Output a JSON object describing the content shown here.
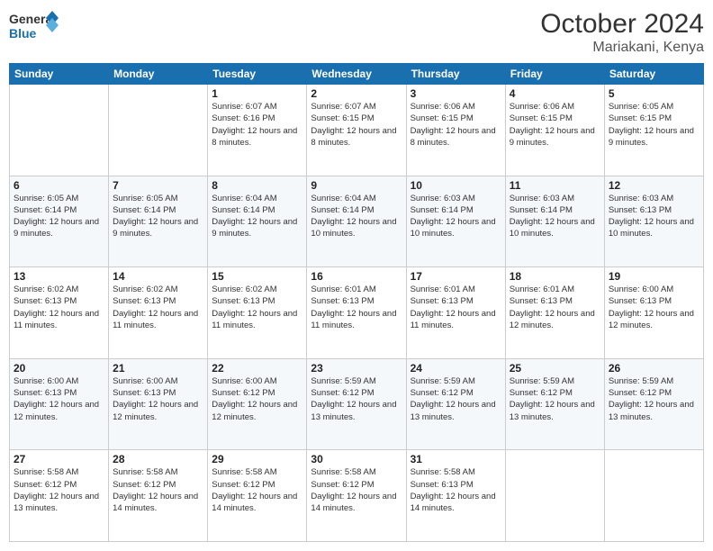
{
  "logo": {
    "line1": "General",
    "line2": "Blue"
  },
  "title": "October 2024",
  "location": "Mariakani, Kenya",
  "days_header": [
    "Sunday",
    "Monday",
    "Tuesday",
    "Wednesday",
    "Thursday",
    "Friday",
    "Saturday"
  ],
  "weeks": [
    [
      {
        "day": "",
        "info": ""
      },
      {
        "day": "",
        "info": ""
      },
      {
        "day": "1",
        "info": "Sunrise: 6:07 AM\nSunset: 6:16 PM\nDaylight: 12 hours and 8 minutes."
      },
      {
        "day": "2",
        "info": "Sunrise: 6:07 AM\nSunset: 6:15 PM\nDaylight: 12 hours and 8 minutes."
      },
      {
        "day": "3",
        "info": "Sunrise: 6:06 AM\nSunset: 6:15 PM\nDaylight: 12 hours and 8 minutes."
      },
      {
        "day": "4",
        "info": "Sunrise: 6:06 AM\nSunset: 6:15 PM\nDaylight: 12 hours and 9 minutes."
      },
      {
        "day": "5",
        "info": "Sunrise: 6:05 AM\nSunset: 6:15 PM\nDaylight: 12 hours and 9 minutes."
      }
    ],
    [
      {
        "day": "6",
        "info": "Sunrise: 6:05 AM\nSunset: 6:14 PM\nDaylight: 12 hours and 9 minutes."
      },
      {
        "day": "7",
        "info": "Sunrise: 6:05 AM\nSunset: 6:14 PM\nDaylight: 12 hours and 9 minutes."
      },
      {
        "day": "8",
        "info": "Sunrise: 6:04 AM\nSunset: 6:14 PM\nDaylight: 12 hours and 9 minutes."
      },
      {
        "day": "9",
        "info": "Sunrise: 6:04 AM\nSunset: 6:14 PM\nDaylight: 12 hours and 10 minutes."
      },
      {
        "day": "10",
        "info": "Sunrise: 6:03 AM\nSunset: 6:14 PM\nDaylight: 12 hours and 10 minutes."
      },
      {
        "day": "11",
        "info": "Sunrise: 6:03 AM\nSunset: 6:14 PM\nDaylight: 12 hours and 10 minutes."
      },
      {
        "day": "12",
        "info": "Sunrise: 6:03 AM\nSunset: 6:13 PM\nDaylight: 12 hours and 10 minutes."
      }
    ],
    [
      {
        "day": "13",
        "info": "Sunrise: 6:02 AM\nSunset: 6:13 PM\nDaylight: 12 hours and 11 minutes."
      },
      {
        "day": "14",
        "info": "Sunrise: 6:02 AM\nSunset: 6:13 PM\nDaylight: 12 hours and 11 minutes."
      },
      {
        "day": "15",
        "info": "Sunrise: 6:02 AM\nSunset: 6:13 PM\nDaylight: 12 hours and 11 minutes."
      },
      {
        "day": "16",
        "info": "Sunrise: 6:01 AM\nSunset: 6:13 PM\nDaylight: 12 hours and 11 minutes."
      },
      {
        "day": "17",
        "info": "Sunrise: 6:01 AM\nSunset: 6:13 PM\nDaylight: 12 hours and 11 minutes."
      },
      {
        "day": "18",
        "info": "Sunrise: 6:01 AM\nSunset: 6:13 PM\nDaylight: 12 hours and 12 minutes."
      },
      {
        "day": "19",
        "info": "Sunrise: 6:00 AM\nSunset: 6:13 PM\nDaylight: 12 hours and 12 minutes."
      }
    ],
    [
      {
        "day": "20",
        "info": "Sunrise: 6:00 AM\nSunset: 6:13 PM\nDaylight: 12 hours and 12 minutes."
      },
      {
        "day": "21",
        "info": "Sunrise: 6:00 AM\nSunset: 6:13 PM\nDaylight: 12 hours and 12 minutes."
      },
      {
        "day": "22",
        "info": "Sunrise: 6:00 AM\nSunset: 6:12 PM\nDaylight: 12 hours and 12 minutes."
      },
      {
        "day": "23",
        "info": "Sunrise: 5:59 AM\nSunset: 6:12 PM\nDaylight: 12 hours and 13 minutes."
      },
      {
        "day": "24",
        "info": "Sunrise: 5:59 AM\nSunset: 6:12 PM\nDaylight: 12 hours and 13 minutes."
      },
      {
        "day": "25",
        "info": "Sunrise: 5:59 AM\nSunset: 6:12 PM\nDaylight: 12 hours and 13 minutes."
      },
      {
        "day": "26",
        "info": "Sunrise: 5:59 AM\nSunset: 6:12 PM\nDaylight: 12 hours and 13 minutes."
      }
    ],
    [
      {
        "day": "27",
        "info": "Sunrise: 5:58 AM\nSunset: 6:12 PM\nDaylight: 12 hours and 13 minutes."
      },
      {
        "day": "28",
        "info": "Sunrise: 5:58 AM\nSunset: 6:12 PM\nDaylight: 12 hours and 14 minutes."
      },
      {
        "day": "29",
        "info": "Sunrise: 5:58 AM\nSunset: 6:12 PM\nDaylight: 12 hours and 14 minutes."
      },
      {
        "day": "30",
        "info": "Sunrise: 5:58 AM\nSunset: 6:12 PM\nDaylight: 12 hours and 14 minutes."
      },
      {
        "day": "31",
        "info": "Sunrise: 5:58 AM\nSunset: 6:13 PM\nDaylight: 12 hours and 14 minutes."
      },
      {
        "day": "",
        "info": ""
      },
      {
        "day": "",
        "info": ""
      }
    ]
  ]
}
